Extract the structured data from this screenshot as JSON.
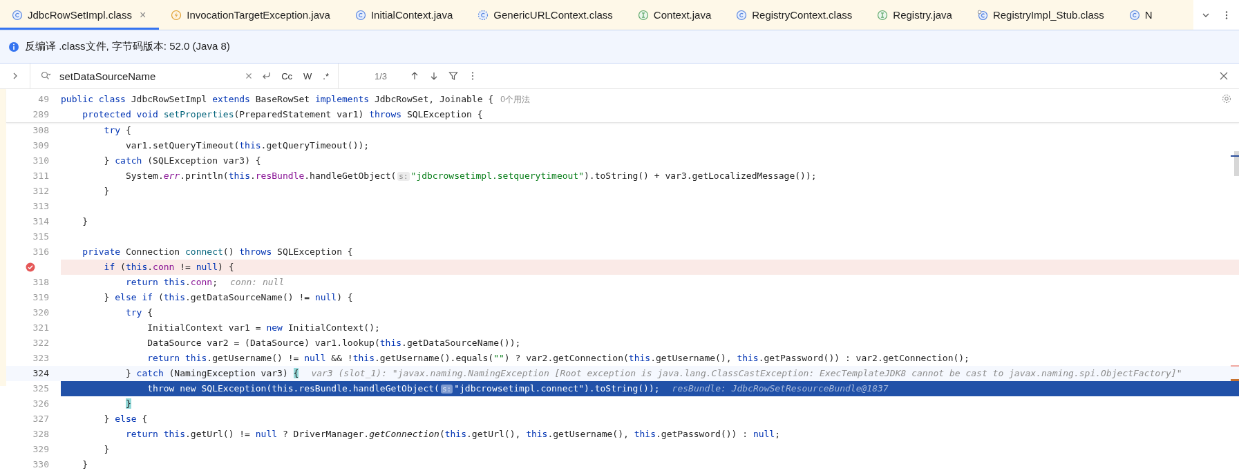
{
  "tabs": [
    {
      "label": "JdbcRowSetImpl.class",
      "kind": "class",
      "selected": true,
      "close": "×"
    },
    {
      "label": "InvocationTargetException.java",
      "kind": "exception",
      "selected": false
    },
    {
      "label": "InitialContext.java",
      "kind": "class",
      "selected": false
    },
    {
      "label": "GenericURLContext.class",
      "kind": "abstract_class",
      "selected": false
    },
    {
      "label": "Context.java",
      "kind": "interface",
      "selected": false
    },
    {
      "label": "RegistryContext.class",
      "kind": "class",
      "selected": false
    },
    {
      "label": "Registry.java",
      "kind": "interface",
      "selected": false
    },
    {
      "label": "RegistryImpl_Stub.class",
      "kind": "stub_class",
      "selected": false
    },
    {
      "label": "N",
      "kind": "class",
      "selected": false
    }
  ],
  "banner": {
    "text": "反编译 .class文件, 字节码版本: 52.0 (Java 8)"
  },
  "search": {
    "value": "setDataSourceName",
    "options": [
      "Cc",
      "W",
      ".*"
    ],
    "count": "1/3"
  },
  "sticky": [
    {
      "number": "49",
      "tokens": [
        {
          "kind": "kw",
          "text": "public class "
        },
        {
          "kind": "plain",
          "text": "JdbcRowSetImpl "
        },
        {
          "kind": "kw",
          "text": "extends "
        },
        {
          "kind": "plain",
          "text": "BaseRowSet "
        },
        {
          "kind": "kw",
          "text": "implements "
        },
        {
          "kind": "plain",
          "text": "JdbcRowSet, Joinable {"
        }
      ],
      "usage": "0个用法"
    },
    {
      "number": "289",
      "tokens": [
        {
          "kind": "kw",
          "text": "    protected void "
        },
        {
          "kind": "decl",
          "text": "setProperties"
        },
        {
          "kind": "plain",
          "text": "(PreparedStatement var1) "
        },
        {
          "kind": "kw",
          "text": "throws "
        },
        {
          "kind": "plain",
          "text": "SQLException {"
        }
      ]
    }
  ],
  "code": [
    {
      "number": "308",
      "kind": "normal",
      "tokens": [
        {
          "kind": "kw",
          "text": "        try"
        },
        {
          "kind": "plain",
          "text": " {"
        }
      ]
    },
    {
      "number": "309",
      "kind": "normal",
      "tokens": [
        {
          "kind": "plain",
          "text": "            var1.setQueryTimeout("
        },
        {
          "kind": "kw",
          "text": "this"
        },
        {
          "kind": "plain",
          "text": ".getQueryTimeout());"
        }
      ]
    },
    {
      "number": "310",
      "kind": "normal",
      "tokens": [
        {
          "kind": "plain",
          "text": "        } "
        },
        {
          "kind": "kw",
          "text": "catch "
        },
        {
          "kind": "plain",
          "text": "(SQLException var3) {"
        }
      ]
    },
    {
      "number": "311",
      "kind": "normal",
      "tokens": [
        {
          "kind": "plain",
          "text": "            System."
        },
        {
          "kind": "static_field",
          "text": "err"
        },
        {
          "kind": "plain",
          "text": ".println("
        },
        {
          "kind": "kw",
          "text": "this"
        },
        {
          "kind": "plain",
          "text": "."
        },
        {
          "kind": "field",
          "text": "resBundle"
        },
        {
          "kind": "plain",
          "text": ".handleGetObject("
        },
        {
          "kind": "param_hint",
          "text": "s:"
        },
        {
          "kind": "str",
          "text": "\"jdbcrowsetimpl.setquerytimeout\""
        },
        {
          "kind": "plain",
          "text": ").toString() + var3.getLocalizedMessage());"
        }
      ]
    },
    {
      "number": "312",
      "kind": "normal",
      "tokens": [
        {
          "kind": "plain",
          "text": "        }"
        }
      ]
    },
    {
      "number": "313",
      "kind": "normal"
    },
    {
      "number": "314",
      "kind": "normal",
      "tokens": [
        {
          "kind": "plain",
          "text": "    }"
        }
      ]
    },
    {
      "number": "315",
      "kind": "normal"
    },
    {
      "number": "316",
      "kind": "normal",
      "tokens": [
        {
          "kind": "kw",
          "text": "    private "
        },
        {
          "kind": "plain",
          "text": "Connection "
        },
        {
          "kind": "decl",
          "text": "connect"
        },
        {
          "kind": "plain",
          "text": "() "
        },
        {
          "kind": "kw",
          "text": "throws "
        },
        {
          "kind": "plain",
          "text": "SQLException {"
        }
      ]
    },
    {
      "kind": "breakpoint",
      "tokens": [
        {
          "kind": "kw",
          "text": "        if "
        },
        {
          "kind": "plain",
          "text": "("
        },
        {
          "kind": "kw",
          "text": "this"
        },
        {
          "kind": "plain",
          "text": "."
        },
        {
          "kind": "field",
          "text": "conn"
        },
        {
          "kind": "plain",
          "text": " != "
        },
        {
          "kind": "kw",
          "text": "null"
        },
        {
          "kind": "plain",
          "text": ") {"
        }
      ]
    },
    {
      "number": "318",
      "kind": "normal",
      "tokens": [
        {
          "kind": "kw",
          "text": "            return this"
        },
        {
          "kind": "plain",
          "text": "."
        },
        {
          "kind": "field",
          "text": "conn"
        },
        {
          "kind": "plain",
          "text": ";"
        }
      ],
      "inlay": "conn: null"
    },
    {
      "number": "319",
      "kind": "normal",
      "tokens": [
        {
          "kind": "plain",
          "text": "        } "
        },
        {
          "kind": "kw",
          "text": "else if "
        },
        {
          "kind": "plain",
          "text": "("
        },
        {
          "kind": "kw",
          "text": "this"
        },
        {
          "kind": "plain",
          "text": ".getDataSourceName() != "
        },
        {
          "kind": "kw",
          "text": "null"
        },
        {
          "kind": "plain",
          "text": ") {"
        }
      ]
    },
    {
      "number": "320",
      "kind": "normal",
      "tokens": [
        {
          "kind": "kw",
          "text": "            try"
        },
        {
          "kind": "plain",
          "text": " {"
        }
      ]
    },
    {
      "number": "321",
      "kind": "normal",
      "tokens": [
        {
          "kind": "plain",
          "text": "                InitialContext var1 = "
        },
        {
          "kind": "kw",
          "text": "new "
        },
        {
          "kind": "plain",
          "text": "InitialContext();"
        }
      ]
    },
    {
      "number": "322",
      "kind": "normal",
      "tokens": [
        {
          "kind": "plain",
          "text": "                DataSource var2 = (DataSource) var1.lookup("
        },
        {
          "kind": "kw",
          "text": "this"
        },
        {
          "kind": "plain",
          "text": ".getDataSourceName());"
        }
      ]
    },
    {
      "number": "323",
      "kind": "normal",
      "tokens": [
        {
          "kind": "kw",
          "text": "                return this"
        },
        {
          "kind": "plain",
          "text": ".getUsername() != "
        },
        {
          "kind": "kw",
          "text": "null"
        },
        {
          "kind": "plain",
          "text": " && !"
        },
        {
          "kind": "kw",
          "text": "this"
        },
        {
          "kind": "plain",
          "text": ".getUsername().equals("
        },
        {
          "kind": "str",
          "text": "\"\""
        },
        {
          "kind": "plain",
          "text": ") ? var2.getConnection("
        },
        {
          "kind": "kw",
          "text": "this"
        },
        {
          "kind": "plain",
          "text": ".getUsername(), "
        },
        {
          "kind": "kw",
          "text": "this"
        },
        {
          "kind": "plain",
          "text": ".getPassword()) : var2.getConnection();"
        }
      ]
    },
    {
      "number": "324",
      "kind": "caret",
      "tokens": [
        {
          "kind": "plain",
          "text": "            } "
        },
        {
          "kind": "kw",
          "text": "catch "
        },
        {
          "kind": "plain",
          "text": "(NamingException var3) "
        },
        {
          "kind": "brace_match",
          "text": "{"
        }
      ],
      "inlay": "var3 (slot_1): \"javax.naming.NamingException [Root exception is java.lang.ClassCastException: ExecTemplateJDK8 cannot be cast to javax.naming.spi.ObjectFactory]\""
    },
    {
      "number": "325",
      "kind": "execution",
      "tokens": [
        {
          "kind": "kw",
          "text": "                throw new "
        },
        {
          "kind": "plain",
          "text": "SQLException("
        },
        {
          "kind": "kw",
          "text": "this"
        },
        {
          "kind": "plain",
          "text": "."
        },
        {
          "kind": "field",
          "text": "resBundle"
        },
        {
          "kind": "plain",
          "text": ".handleGetObject("
        },
        {
          "kind": "param_hint",
          "text": "s:"
        },
        {
          "kind": "str",
          "text": "\"jdbcrowsetimpl.connect\""
        },
        {
          "kind": "plain",
          "text": ").toString());"
        }
      ],
      "inlay": "resBundle: JdbcRowSetResourceBundle@1837"
    },
    {
      "number": "326",
      "kind": "normal",
      "tokens": [
        {
          "kind": "brace_match",
          "text": "            }"
        }
      ]
    },
    {
      "number": "327",
      "kind": "normal",
      "tokens": [
        {
          "kind": "plain",
          "text": "        } "
        },
        {
          "kind": "kw",
          "text": "else"
        },
        {
          "kind": "plain",
          "text": " {"
        }
      ]
    },
    {
      "number": "328",
      "kind": "normal",
      "tokens": [
        {
          "kind": "kw",
          "text": "            return this"
        },
        {
          "kind": "plain",
          "text": ".getUrl() != "
        },
        {
          "kind": "kw",
          "text": "null"
        },
        {
          "kind": "plain",
          "text": " ? DriverManager."
        },
        {
          "kind": "static_method",
          "text": "getConnection"
        },
        {
          "kind": "plain",
          "text": "("
        },
        {
          "kind": "kw",
          "text": "this"
        },
        {
          "kind": "plain",
          "text": ".getUrl(), "
        },
        {
          "kind": "kw",
          "text": "this"
        },
        {
          "kind": "plain",
          "text": ".getUsername(), "
        },
        {
          "kind": "kw",
          "text": "this"
        },
        {
          "kind": "plain",
          "text": ".getPassword()) : "
        },
        {
          "kind": "kw",
          "text": "null"
        },
        {
          "kind": "plain",
          "text": ";"
        }
      ]
    },
    {
      "number": "329",
      "kind": "normal",
      "tokens": [
        {
          "kind": "plain",
          "text": "        }"
        }
      ]
    },
    {
      "number": "330",
      "kind": "normal",
      "tokens": [
        {
          "kind": "plain",
          "text": "    }"
        }
      ]
    }
  ]
}
